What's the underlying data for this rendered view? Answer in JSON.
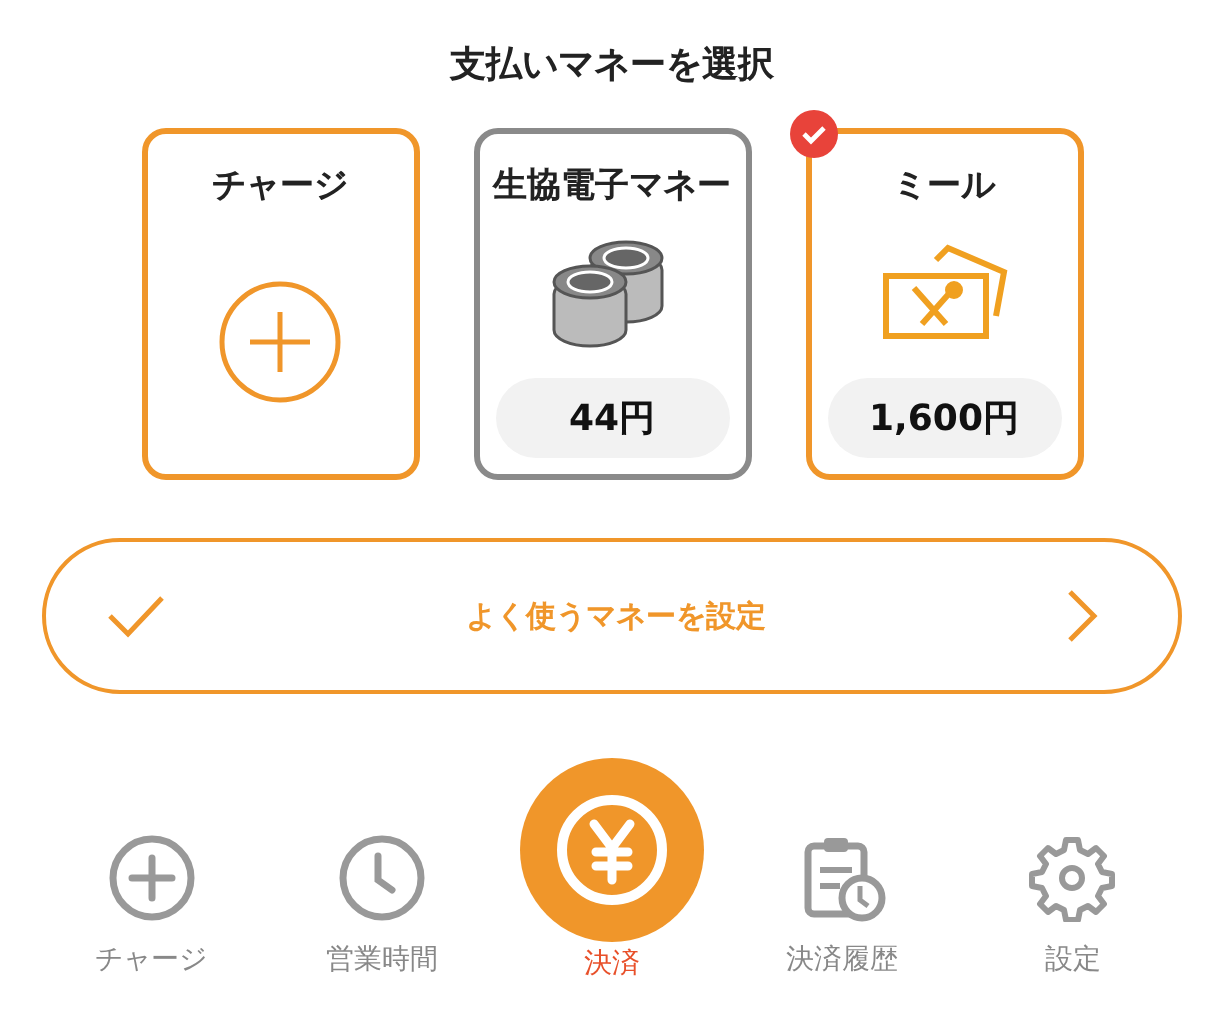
{
  "title": "支払いマネーを選択",
  "cards": [
    {
      "kind": "charge",
      "label": "チャージ"
    },
    {
      "kind": "coins",
      "label": "生協電子マネー",
      "amount": "44円",
      "selected": false
    },
    {
      "kind": "meal",
      "label": "ミール",
      "amount": "1,600円",
      "selected": true
    }
  ],
  "favorite_button": {
    "label": "よく使うマネーを設定"
  },
  "nav": [
    {
      "label": "チャージ",
      "selected": false
    },
    {
      "label": "営業時間",
      "selected": false
    },
    {
      "label": "決済",
      "selected": true
    },
    {
      "label": "決済履歴",
      "selected": false
    },
    {
      "label": "設定",
      "selected": false
    }
  ]
}
